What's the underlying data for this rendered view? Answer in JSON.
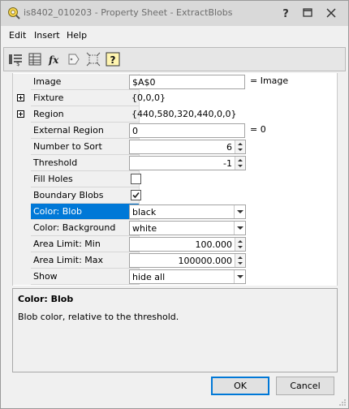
{
  "window": {
    "title": "is8402_010203 - Property Sheet - ExtractBlobs"
  },
  "menu": [
    "Edit",
    "Insert",
    "Help"
  ],
  "toolbar": [
    "categorized-icon",
    "alphabetic-icon",
    "function-icon",
    "tag-icon",
    "select-region-icon",
    "help-icon"
  ],
  "properties": {
    "image": {
      "label": "Image",
      "value": "$A$0",
      "suffix": "= Image"
    },
    "fixture": {
      "label": "Fixture",
      "value": "{0,0,0}"
    },
    "region": {
      "label": "Region",
      "value": "{440,580,320,440,0,0}"
    },
    "external_region": {
      "label": "External Region",
      "value": "0",
      "suffix": "= 0"
    },
    "number_to_sort": {
      "label": "Number to Sort",
      "value": "6"
    },
    "threshold": {
      "label": "Threshold",
      "value": "-1"
    },
    "fill_holes": {
      "label": "Fill Holes",
      "checked": false
    },
    "boundary_blobs": {
      "label": "Boundary Blobs",
      "checked": true
    },
    "color_blob": {
      "label": "Color: Blob",
      "value": "black"
    },
    "color_background": {
      "label": "Color: Background",
      "value": "white"
    },
    "area_limit_min": {
      "label": "Area Limit: Min",
      "value": "100.000"
    },
    "area_limit_max": {
      "label": "Area Limit: Max",
      "value": "100000.000"
    },
    "show": {
      "label": "Show",
      "value": "hide all"
    }
  },
  "description": {
    "title": "Color: Blob",
    "text": "Blob color, relative to the threshold."
  },
  "buttons": {
    "ok": "OK",
    "cancel": "Cancel"
  },
  "colors": {
    "selection": "#0078d7",
    "titlebar": "#d9d9d9"
  }
}
